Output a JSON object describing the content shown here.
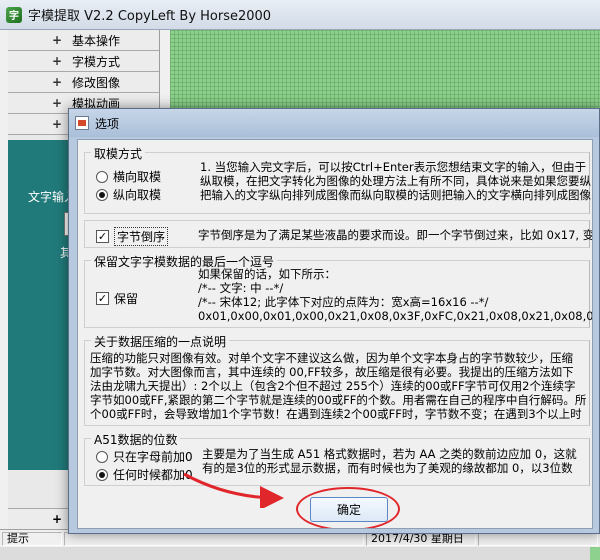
{
  "main_window": {
    "title": "字模提取 V2.2  CopyLeft By Horse2000",
    "nav_items": [
      {
        "symbol": "+",
        "label": "基本操作"
      },
      {
        "symbol": "+",
        "label": "字模方式"
      },
      {
        "symbol": "+",
        "label": "修改图像"
      },
      {
        "symbol": "+",
        "label": "模拟动画"
      },
      {
        "symbol": "+",
        "label": "参"
      }
    ],
    "teal_labels": [
      "文字输入区",
      "其他"
    ],
    "bottom_nav": {
      "symbol": "+",
      "label": "选"
    },
    "status": {
      "hint_label": "提示",
      "date_text": "2017/4/30 星期日"
    }
  },
  "dialog": {
    "title": "选项",
    "mode_group": {
      "title": "取模方式",
      "options": [
        {
          "label": "横向取模",
          "selected": false
        },
        {
          "label": "纵向取模",
          "selected": true
        }
      ],
      "description": [
        "1. 当您输入完文字后，可以按Ctrl+Enter表示您想结束文字的输入，但由于",
        "纵取模，在把文字转化为图像的处理方法上有所不同，具体说来是如果您要纵",
        "把输入的文字纵向排列成图像而纵向取模的话则把输入的文字横向排列成图像"
      ]
    },
    "byte_reverse": {
      "label": "字节倒序",
      "checked": true,
      "description": "字节倒序是为了满足某些液晶的要求而设。即一个字节倒过来，比如 0x17, 变"
    },
    "keep_group": {
      "title": "保留文字字模数据的最后一个逗号",
      "label": "保留",
      "checked": true,
      "description": [
        "如果保留的话，如下所示：",
        "/*--  文字:  中  --*/",
        "/*--  宋体12;  此字体下对应的点阵为：宽x高=16x16   --*/",
        "0x01,0x00,0x01,0x00,0x21,0x08,0x3F,0xFC,0x21,0x08,0x21,0x08,0x21,0x"
      ]
    },
    "compress_group": {
      "title": "关于数据压缩的一点说明",
      "description": [
        "压缩的功能只对图像有效。对单个文字不建议这么做，因为单个文字本身占的字节数较少，压缩",
        "加字节数。对大图像而言，其中连续的 00,FF较多，故压缩是很有必要。我提出的压缩方法如下",
        "法由龙啸九天提出）: 2个以上（包含2个但不超过 255个）连续的00或FF字节可仅用2个连续字",
        "字节如00或FF,紧跟的第二个字节就是连续的00或FF的个数。用者需在自己的程序中自行解码。所",
        "个00或FF时，会导致增加1个字节数！在遇到连续2个00或FF时，字节数不变；在遇到3个以上时"
      ]
    },
    "a51_group": {
      "title": "A51数据的位数",
      "options": [
        {
          "label": "只在字母前加0",
          "selected": false
        },
        {
          "label": "任何时候都加0",
          "selected": true
        }
      ],
      "description": [
        "主要是为了当生成  A51 格式数据时，若为 AA 之类的数前边应加 0，这就",
        "有的是3位的形式显示数据，而有时候也为了美观的缘故都加 0，以3位数"
      ]
    },
    "ok_label": "确定"
  },
  "annotation": {
    "color": "#e0262a"
  }
}
